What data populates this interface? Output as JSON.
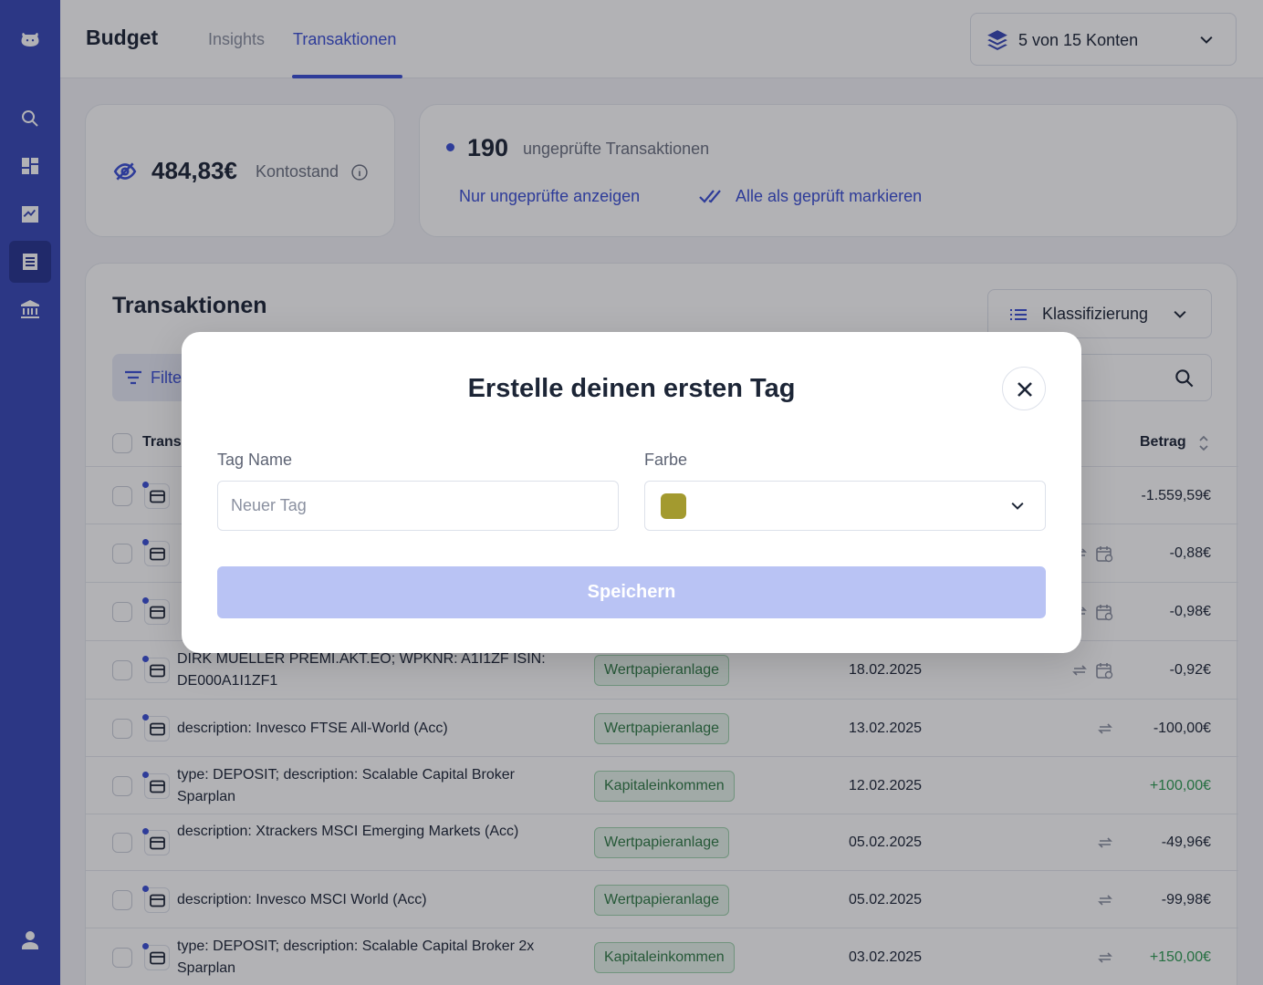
{
  "app": {
    "brand": "Budget",
    "tabs": [
      {
        "label": "Insights",
        "active": false
      },
      {
        "label": "Transaktionen",
        "active": true
      }
    ],
    "account_selector": "5 von 15 Konten"
  },
  "sidebar": {
    "items": [
      {
        "icon": "logo-icon"
      },
      {
        "icon": "search-icon"
      },
      {
        "icon": "dashboard-icon"
      },
      {
        "icon": "chart-icon"
      },
      {
        "icon": "transactions-icon",
        "active": true
      },
      {
        "icon": "bank-icon"
      },
      {
        "icon": "profile-icon"
      }
    ]
  },
  "balance": {
    "value": "484,83€",
    "label": "Kontostand"
  },
  "unchecked": {
    "count": "190",
    "label": "ungeprüfte Transaktionen",
    "show_link": "Nur ungeprüfte anzeigen",
    "mark_all_link": "Alle als geprüft markieren"
  },
  "transactions": {
    "title": "Transaktionen",
    "classification_label": "Klassifizierung",
    "filter_label": "Filter",
    "columns": {
      "transaction": "Trans",
      "amount": "Betrag"
    },
    "rows": [
      {
        "desc": "",
        "category": "",
        "date": "",
        "amount": "-1.559,59€",
        "icons": []
      },
      {
        "desc": "",
        "category": "",
        "date": "",
        "amount": "-0,88€",
        "icons": [
          "switch",
          "calendar"
        ]
      },
      {
        "desc": "",
        "category": "",
        "date": "",
        "amount": "-0,98€",
        "icons": [
          "switch",
          "calendar"
        ]
      },
      {
        "desc": "DIRK MUELLER PREMI.AKT.EO; WPKNR: A1I1ZF ISIN: DE000A1I1ZF1",
        "category": "Wertpapieranlage",
        "date": "18.02.2025",
        "amount": "-0,92€",
        "icons": [
          "switch",
          "calendar"
        ]
      },
      {
        "desc": "description: Invesco FTSE All-World (Acc)",
        "category": "Wertpapieranlage",
        "date": "13.02.2025",
        "amount": "-100,00€",
        "icons": [
          "switch"
        ]
      },
      {
        "desc": "type: DEPOSIT; description: Scalable Capital Broker Sparplan",
        "category": "Kapitaleinkommen",
        "date": "12.02.2025",
        "amount": "+100,00€",
        "icons": [],
        "positive": true
      },
      {
        "desc": "description: Xtrackers MSCI Emerging Markets (Acc)",
        "category": "Wertpapieranlage",
        "date": "05.02.2025",
        "amount": "-49,96€",
        "icons": [
          "switch"
        ]
      },
      {
        "desc": "description: Invesco MSCI World (Acc)",
        "category": "Wertpapieranlage",
        "date": "05.02.2025",
        "amount": "-99,98€",
        "icons": [
          "switch"
        ]
      },
      {
        "desc": "type: DEPOSIT; description: Scalable Capital Broker 2x Sparplan",
        "category": "Kapitaleinkommen",
        "date": "03.02.2025",
        "amount": "+150,00€",
        "icons": [
          "switch"
        ],
        "positive": true
      }
    ]
  },
  "modal": {
    "title": "Erstelle deinen ersten Tag",
    "name_label": "Tag Name",
    "name_placeholder": "Neuer Tag",
    "name_value": "",
    "color_label": "Farbe",
    "color_value": "#a39a2f",
    "save_label": "Speichern"
  },
  "colors": {
    "accent": "#3b4fd6",
    "sidebar": "#3848b8",
    "positive": "#2e9b52",
    "save_disabled": "#b9c3f4"
  }
}
